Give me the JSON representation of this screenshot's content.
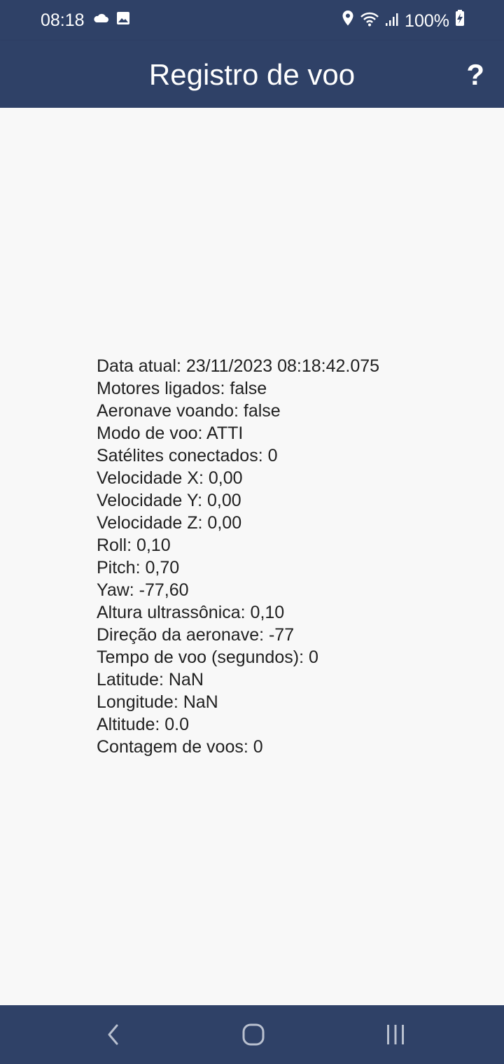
{
  "status_bar": {
    "time": "08:18",
    "battery": "100%",
    "left_icons": [
      "cloud-icon",
      "image-icon"
    ],
    "right_icons": [
      "location-icon",
      "wifi-icon",
      "signal-icon",
      "battery-charging-icon"
    ]
  },
  "app_bar": {
    "title": "Registro de voo",
    "help_label": "?"
  },
  "telemetry": [
    "Data atual: 23/11/2023 08:18:42.075",
    "Motores ligados: false",
    "Aeronave voando: false",
    "Modo de voo: ATTI",
    "Satélites conectados: 0",
    "Velocidade X: 0,00",
    "Velocidade Y: 0,00",
    "Velocidade Z: 0,00",
    "Roll: 0,10",
    "Pitch: 0,70",
    "Yaw: -77,60",
    "Altura ultrassônica: 0,10",
    "Direção da aeronave: -77",
    "Tempo de voo (segundos): 0",
    "Latitude: NaN",
    "Longitude: NaN",
    "Altitude: 0.0",
    "Contagem de voos: 0"
  ],
  "nav_bar": {
    "buttons": [
      "back-icon",
      "home-icon",
      "recent-apps-icon"
    ]
  },
  "colors": {
    "primary": "#2f4167",
    "background": "#f8f8f8",
    "text": "#1f1f1f",
    "on_primary": "#ffffff"
  }
}
